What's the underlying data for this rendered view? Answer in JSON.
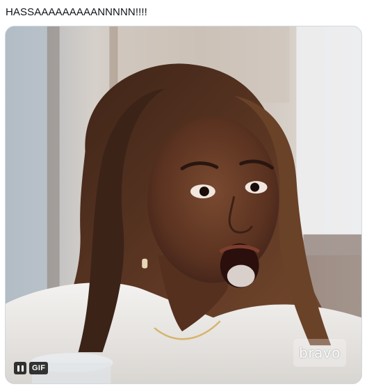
{
  "tweet": {
    "text": "HASSAAAAAAAAANNNNN!!!!"
  },
  "media": {
    "type": "gif",
    "gif_label": "GIF",
    "watermark": "bravo",
    "controls": {
      "pause_icon": "pause-icon"
    }
  },
  "colors": {
    "text": "#0f1419",
    "border": "#cfd9de",
    "badge_bg": "#000000"
  }
}
